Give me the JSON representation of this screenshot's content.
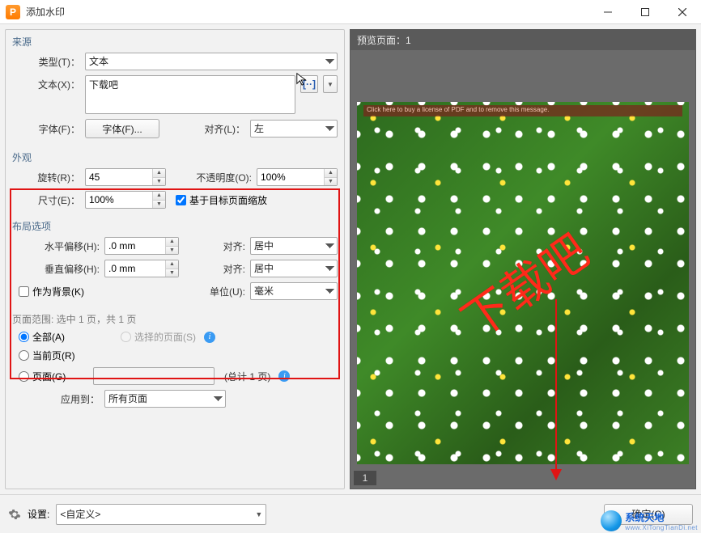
{
  "window": {
    "title": "添加水印"
  },
  "source": {
    "section_label": "来源",
    "type_label": "类型(T)：",
    "type_value": "文本",
    "text_label": "文本(X)：",
    "text_value": "下载吧",
    "font_label": "字体(F)：",
    "font_btn": "字体(F)...",
    "align_label": "对齐(L)：",
    "align_value": "左"
  },
  "appearance": {
    "section_label": "外观",
    "rotate_label": "旋转(R)：",
    "rotate_value": "45",
    "opacity_label": "不透明度(O):",
    "opacity_value": "100%",
    "scale_label": "尺寸(E)：",
    "scale_value": "100%",
    "scale_checkbox": "基于目标页面缩放"
  },
  "layout": {
    "section_label": "布局选项",
    "hoffset_label": "水平偏移(H):",
    "hoffset_value": ".0 mm",
    "voffset_label": "垂直偏移(H):",
    "voffset_value": ".0 mm",
    "halign_label": "对齐:",
    "halign_value": "居中",
    "valign_label": "对齐:",
    "valign_value": "居中",
    "unit_label": "单位(U):",
    "unit_value": "毫米",
    "as_bg_label": "作为背景(K)"
  },
  "range": {
    "summary": "页面范围: 选中 1 页，共 1 页",
    "all_label": "全部(A)",
    "selected_label": "选择的页面(S)",
    "current_label": "当前页(R)",
    "pages_label": "页面(G)",
    "pages_value": "",
    "pages_total": "(总计 1 页)",
    "apply_label": "应用到：",
    "apply_value": "所有页面"
  },
  "preview": {
    "header": "预览页面：1",
    "watermark_text": "下载吧",
    "trial_banner": "Click here to buy a license of PDF and to remove this message.",
    "page_num": "1"
  },
  "bottom": {
    "settings_label": "设置:",
    "settings_value": "<自定义>",
    "ok": "确定(O)"
  },
  "brand": {
    "name": "系统天地",
    "url": "www.XiTongTianDi.net"
  },
  "icons": {
    "bracket": "[··]",
    "caret": "▼"
  }
}
